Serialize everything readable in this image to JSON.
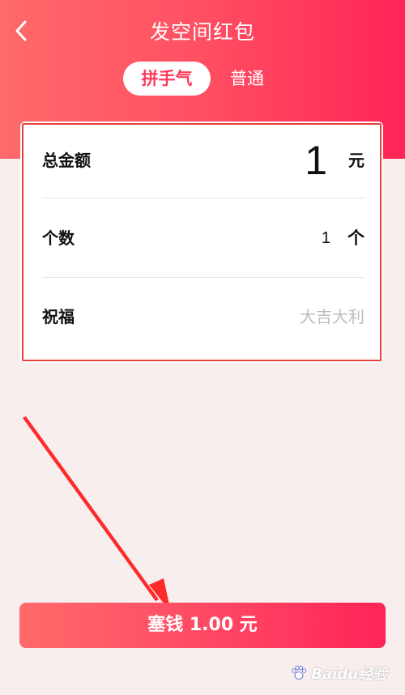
{
  "header": {
    "title": "发空间红包",
    "tabs": [
      {
        "label": "拼手气",
        "active": true
      },
      {
        "label": "普通",
        "active": false
      }
    ]
  },
  "form": {
    "amount": {
      "label": "总金额",
      "value": "1",
      "unit": "元"
    },
    "count": {
      "label": "个数",
      "value": "1",
      "unit": "个"
    },
    "blessing": {
      "label": "祝福",
      "placeholder": "大吉大利"
    }
  },
  "submit": {
    "label": "塞钱 1.00 元"
  },
  "watermark": {
    "text": "Baidu经验"
  },
  "colors": {
    "accent_start": "#ff6a6a",
    "accent_end": "#ff2457",
    "background": "#f8eeee",
    "highlight_border": "#e8403a",
    "arrow": "#ff2a2a"
  },
  "icons": {
    "back": "chevron-left-icon"
  }
}
